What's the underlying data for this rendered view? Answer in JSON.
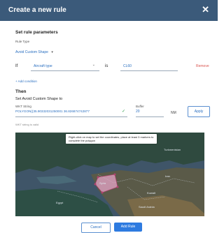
{
  "dialog": {
    "title": "Create a new rule",
    "close_glyph": "✕"
  },
  "params": {
    "heading": "Set rule parameters",
    "rule_type_label": "Rule Type",
    "rule_type_value": "Avoid Custom Shape",
    "rule_type_chevron": "▾"
  },
  "condition": {
    "if_label": "If",
    "field_value": "Aircraft type",
    "field_chevron": "⌄",
    "operator": "is",
    "value": "CL60",
    "remove_label": "Remove",
    "add_label": "+ Add condition"
  },
  "then": {
    "heading": "Then",
    "action_label": "Set Avoid Custom Shape to",
    "wkt_label": "WKT String",
    "wkt_value": "POLYGON((35.90332031250001 36.826874742877",
    "valid_check": "✓",
    "buffer_label": "Buffer",
    "buffer_value": "20",
    "buffer_unit": "NM",
    "apply_label": "Apply",
    "wkt_status": "WKT string is valid"
  },
  "map": {
    "tooltip": "Right-click on map to set the coordinates, place at least 3 markers to complete the polygon",
    "labels": [
      "Turkmenistan",
      "Syria",
      "Iran",
      "Egypt",
      "Saudi Arabia",
      "Kuwait"
    ]
  },
  "footer": {
    "cancel_label": "Cancel",
    "add_rule_label": "Add Rule"
  },
  "colors": {
    "header_bg": "#3b5a7a",
    "link_blue": "#2a6fc0",
    "primary_button": "#2e7be0",
    "remove_red": "#d9534f",
    "polygon_fill": "#e8a6c8"
  }
}
